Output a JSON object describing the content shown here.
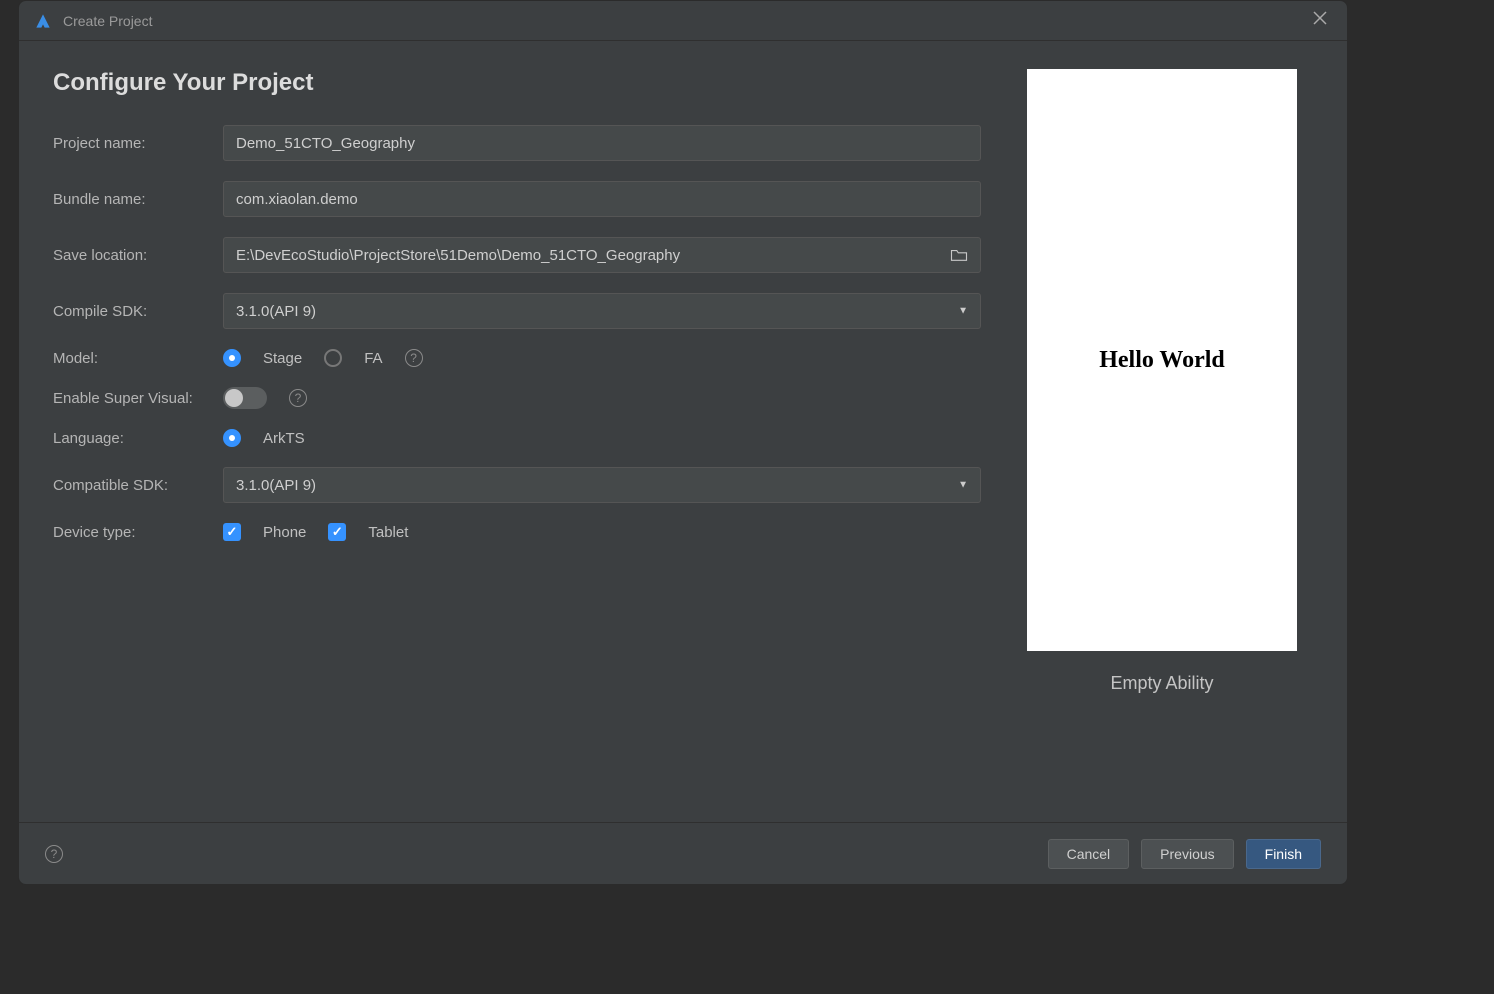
{
  "titlebar": {
    "title": "Create Project"
  },
  "page": {
    "heading": "Configure Your Project"
  },
  "labels": {
    "projectName": "Project name:",
    "bundleName": "Bundle name:",
    "saveLocation": "Save location:",
    "compileSdk": "Compile SDK:",
    "model": "Model:",
    "enableSuperVisual": "Enable Super Visual:",
    "language": "Language:",
    "compatibleSdk": "Compatible SDK:",
    "deviceType": "Device type:"
  },
  "values": {
    "projectName": "Demo_51CTO_Geography",
    "bundleName": "com.xiaolan.demo",
    "saveLocation": "E:\\DevEcoStudio\\ProjectStore\\51Demo\\Demo_51CTO_Geography",
    "compileSdk": "3.1.0(API 9)",
    "compatibleSdk": "3.1.0(API 9)"
  },
  "model": {
    "options": [
      {
        "label": "Stage",
        "selected": true
      },
      {
        "label": "FA",
        "selected": false
      }
    ]
  },
  "enableSuperVisual": false,
  "language": {
    "options": [
      {
        "label": "ArkTS",
        "selected": true
      }
    ]
  },
  "deviceType": {
    "options": [
      {
        "label": "Phone",
        "checked": true
      },
      {
        "label": "Tablet",
        "checked": true
      }
    ]
  },
  "preview": {
    "text": "Hello World",
    "caption": "Empty Ability"
  },
  "buttons": {
    "cancel": "Cancel",
    "previous": "Previous",
    "finish": "Finish"
  }
}
